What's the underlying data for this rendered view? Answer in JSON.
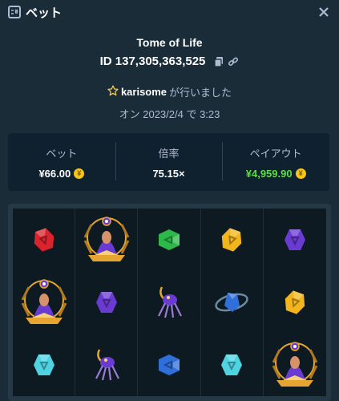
{
  "header": {
    "title": "ベット",
    "bet_icon": "bet-slip-icon",
    "close_icon": "close-icon"
  },
  "game": {
    "title": "Tome of Life",
    "id_label": "ID 137,305,363,525",
    "copy_icon": "copy-icon",
    "link_icon": "link-icon"
  },
  "player": {
    "star_icon": "star-icon",
    "name": "karisome",
    "suffix": "が行いました"
  },
  "date": "オン 2023/2/4 で 3:23",
  "stats": {
    "bet": {
      "label": "ベット",
      "value": "¥66.00"
    },
    "multiplier": {
      "label": "倍率",
      "value": "75.15×"
    },
    "payout": {
      "label": "ペイアウト",
      "value": "¥4,959.90"
    },
    "coin_symbol": "¥"
  },
  "board": {
    "rows": [
      [
        "red-rune-gem",
        "golden-spider-priestess",
        "green-rune-gem",
        "yellow-rune-gem",
        "purple-rune-gem"
      ],
      [
        "golden-spider-priestess",
        "purple-rune-gem",
        "purple-spider",
        "blue-orb-ring",
        "yellow-rune-gem"
      ],
      [
        "cyan-rune-gem",
        "purple-spider",
        "blue-rune-gem",
        "cyan-rune-gem",
        "golden-spider-priestess"
      ]
    ],
    "colors": {
      "red": "#d9232e",
      "green": "#2db84a",
      "yellow": "#f2b51d",
      "purple": "#6a3bd1",
      "cyan": "#4fd3e0",
      "blue": "#2f6fd9",
      "gold": "#e6a531"
    }
  },
  "colors": {
    "background": "#1a2c38",
    "panel": "#0f212e",
    "muted_text": "#b1bad3",
    "payout_green": "#5ddf3d",
    "coin": "#f5c518"
  }
}
